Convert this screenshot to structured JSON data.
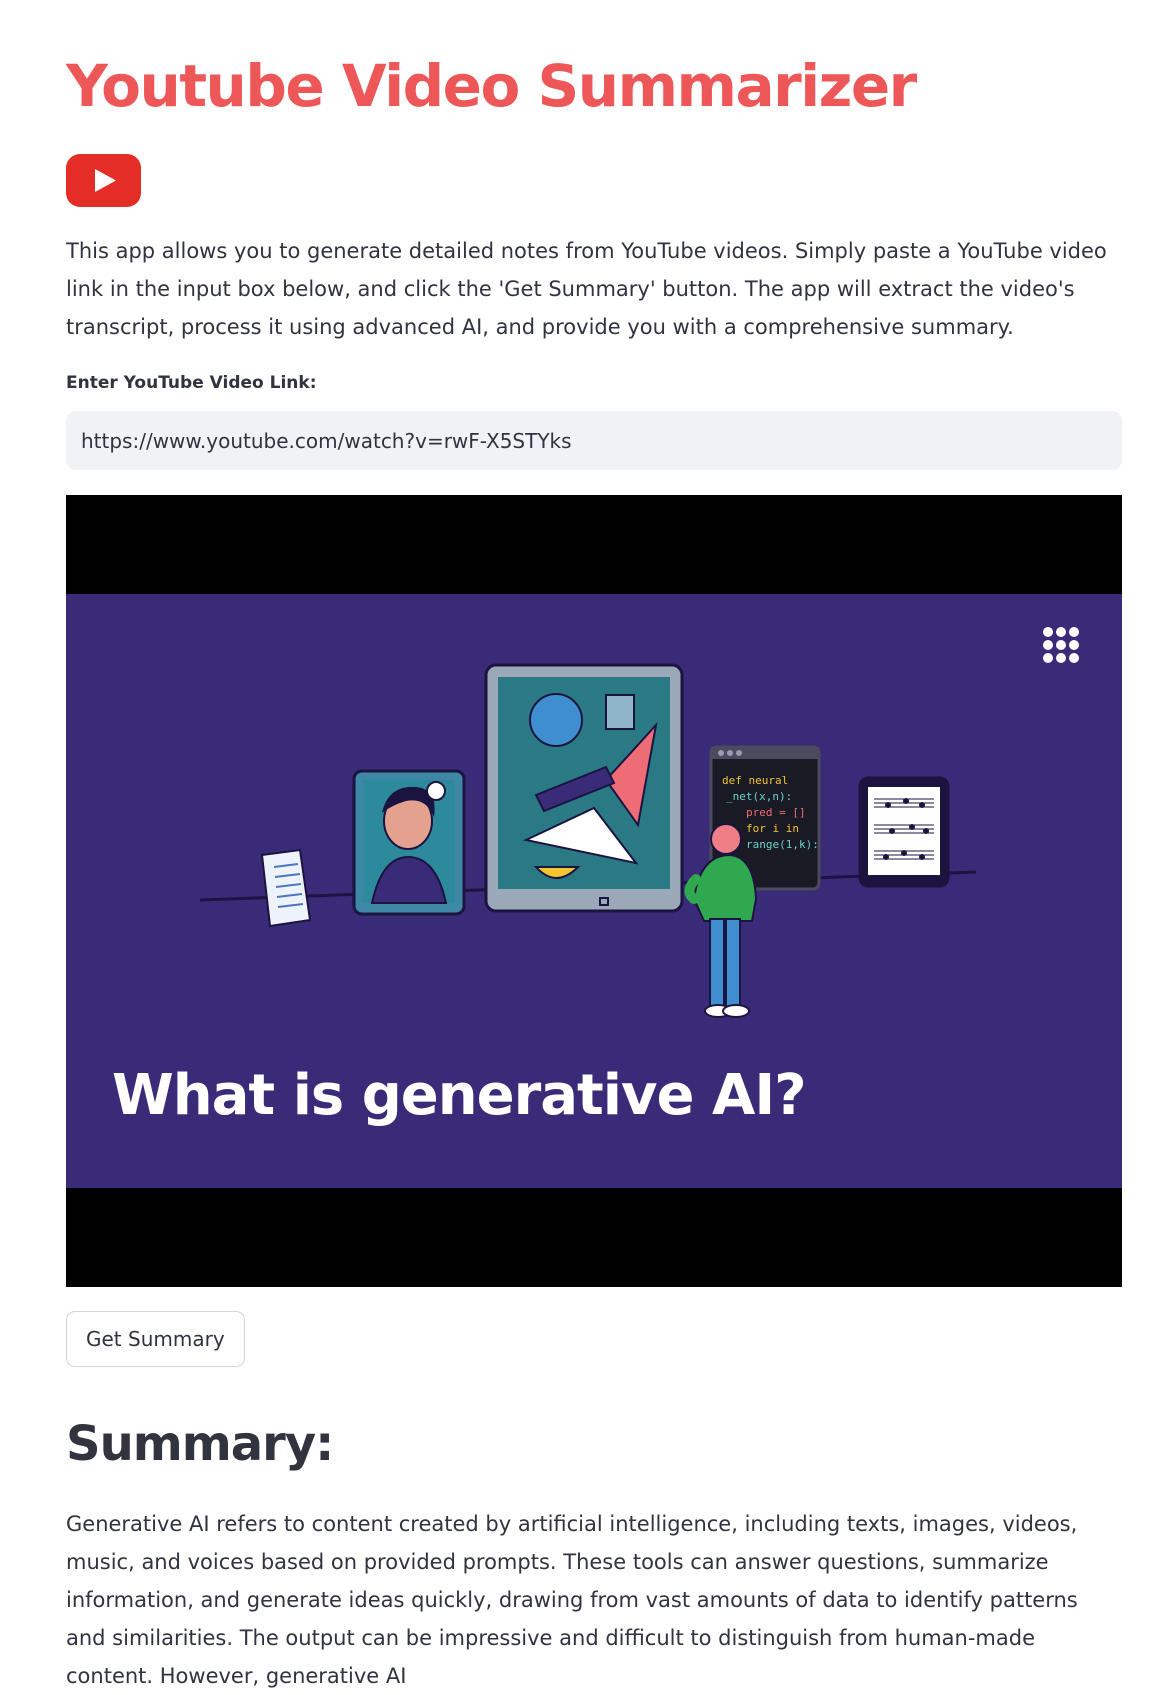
{
  "app": {
    "title": "Youtube Video Summarizer",
    "logo_icon": "youtube-play-icon",
    "intro": "This app allows you to generate detailed notes from YouTube videos. Simply paste a YouTube video link in the input box below, and click the 'Get Summary' button. The app will extract the video's transcript, process it using advanced AI, and provide you with a comprehensive summary."
  },
  "input": {
    "label": "Enter YouTube Video Link:",
    "value": "https://www.youtube.com/watch?v=rwF-X5STYks"
  },
  "video": {
    "caption": "What is generative AI?",
    "code_lines": [
      "def neural",
      "_net(x,n):",
      "pred = []",
      "for i in",
      "range(1,k):"
    ]
  },
  "button": {
    "label": "Get Summary"
  },
  "summary": {
    "heading": "Summary:",
    "text": "Generative AI refers to content created by artificial intelligence, including texts, images, videos, music, and voices based on provided prompts. These tools can answer questions, summarize information, and generate ideas quickly, drawing from vast amounts of data to identify patterns and similarities. The output can be impressive and difficult to distinguish from human-made content. However, generative AI"
  },
  "colors": {
    "accent": "#ed5757",
    "youtube_red": "#e52d27",
    "video_bg": "#3a2b79",
    "input_bg": "#f0f2f6",
    "text": "#31333f"
  }
}
